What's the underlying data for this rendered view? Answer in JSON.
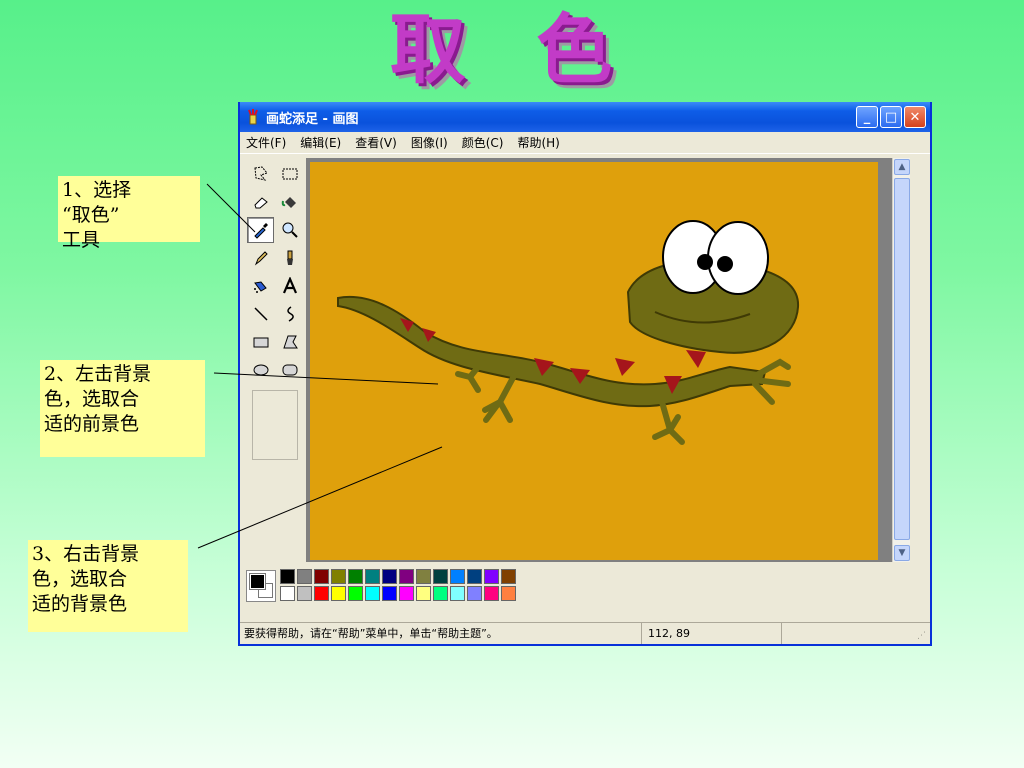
{
  "slide": {
    "title": "取 色"
  },
  "callouts": [
    {
      "text": "1、选择\n“取色”\n工具"
    },
    {
      "text": "2、左击背景\n色，选取合\n适的前景色"
    },
    {
      "text": "3、右击背景\n色，选取合\n适的背景色"
    }
  ],
  "window": {
    "title": "画蛇添足 - 画图",
    "buttons": {
      "minimize": "_",
      "maximize": "□",
      "close": "✕"
    }
  },
  "menu": [
    "文件(F)",
    "编辑(E)",
    "查看(V)",
    "图像(I)",
    "颜色(C)",
    "帮助(H)"
  ],
  "tools": [
    "free-select",
    "rect-select",
    "eraser",
    "fill",
    "color-picker",
    "magnifier",
    "pencil",
    "brush",
    "airbrush",
    "text",
    "line",
    "curve",
    "rectangle",
    "polygon",
    "ellipse",
    "rounded-rectangle"
  ],
  "active_tool": "color-picker",
  "canvas": {
    "background": "#dfa00c"
  },
  "palette": {
    "foreground": "#000000",
    "background": "#ffffff",
    "row1": [
      "#000000",
      "#808080",
      "#800000",
      "#808000",
      "#008000",
      "#008080",
      "#000080",
      "#800080",
      "#808040",
      "#004040",
      "#0080ff",
      "#004080",
      "#8000ff",
      "#804000"
    ],
    "row2": [
      "#ffffff",
      "#c0c0c0",
      "#ff0000",
      "#ffff00",
      "#00ff00",
      "#00ffff",
      "#0000ff",
      "#ff00ff",
      "#ffff80",
      "#00ff80",
      "#80ffff",
      "#8080ff",
      "#ff0080",
      "#ff8040"
    ]
  },
  "status": {
    "help_text": "要获得帮助，请在“帮助”菜单中，单击“帮助主题”。",
    "coords": "112, 89"
  }
}
